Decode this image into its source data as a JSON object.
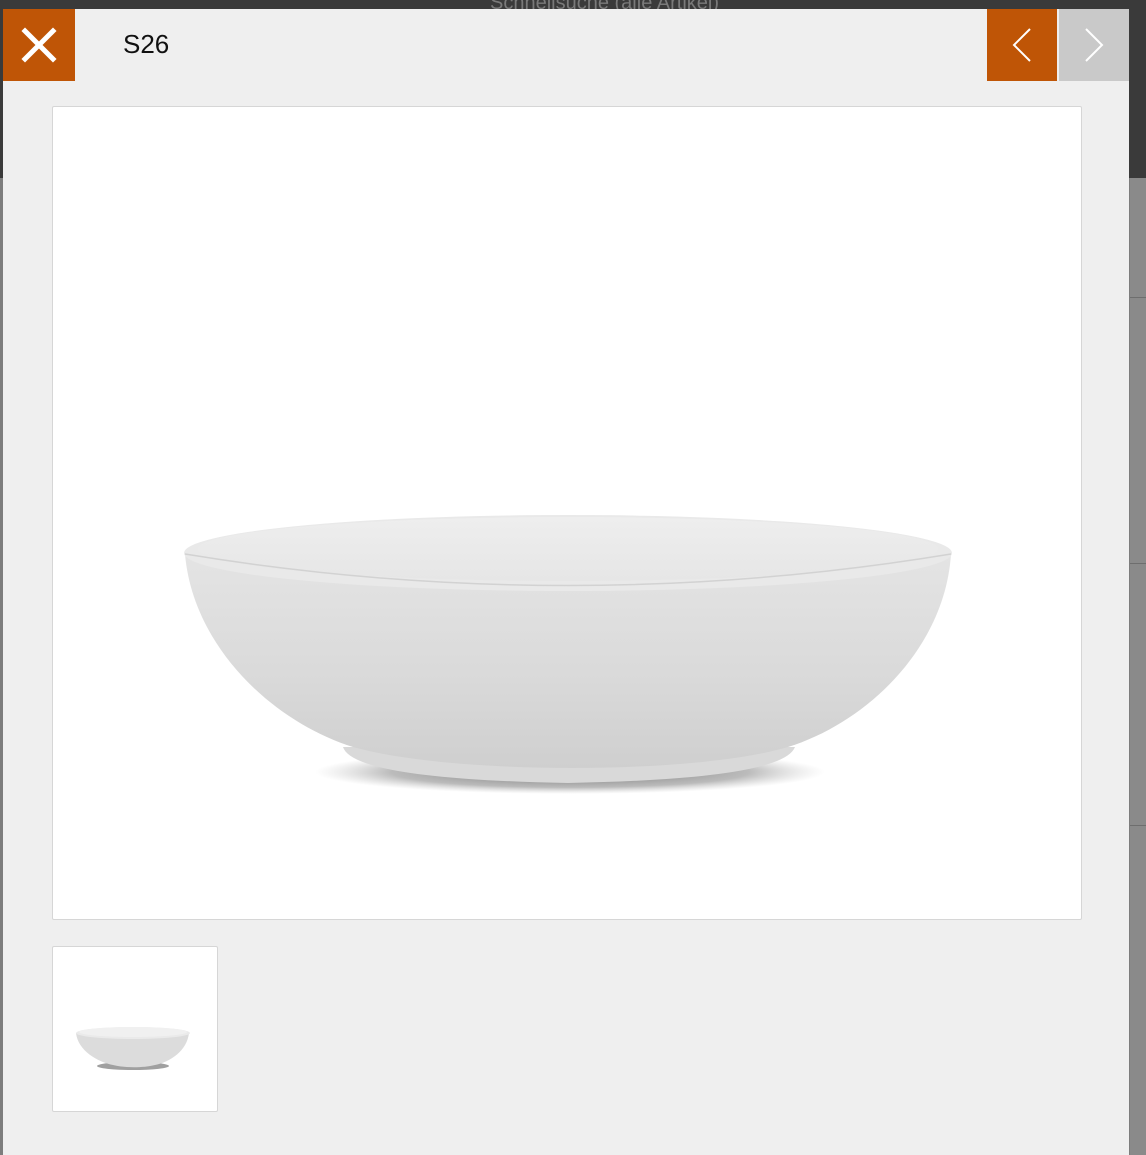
{
  "backdrop": {
    "search_placeholder": "Schnellsuche (alle Artikel)"
  },
  "lightbox": {
    "title": "S26",
    "close_icon": "close-icon",
    "prev_icon": "chevron-left-icon",
    "next_icon": "chevron-right-icon",
    "thumbnails_count": 1
  },
  "colors": {
    "accent": "#bf5506",
    "next_disabled": "#c9c9c9",
    "modal_bg": "#efefef",
    "image_bg": "#ffffff"
  }
}
